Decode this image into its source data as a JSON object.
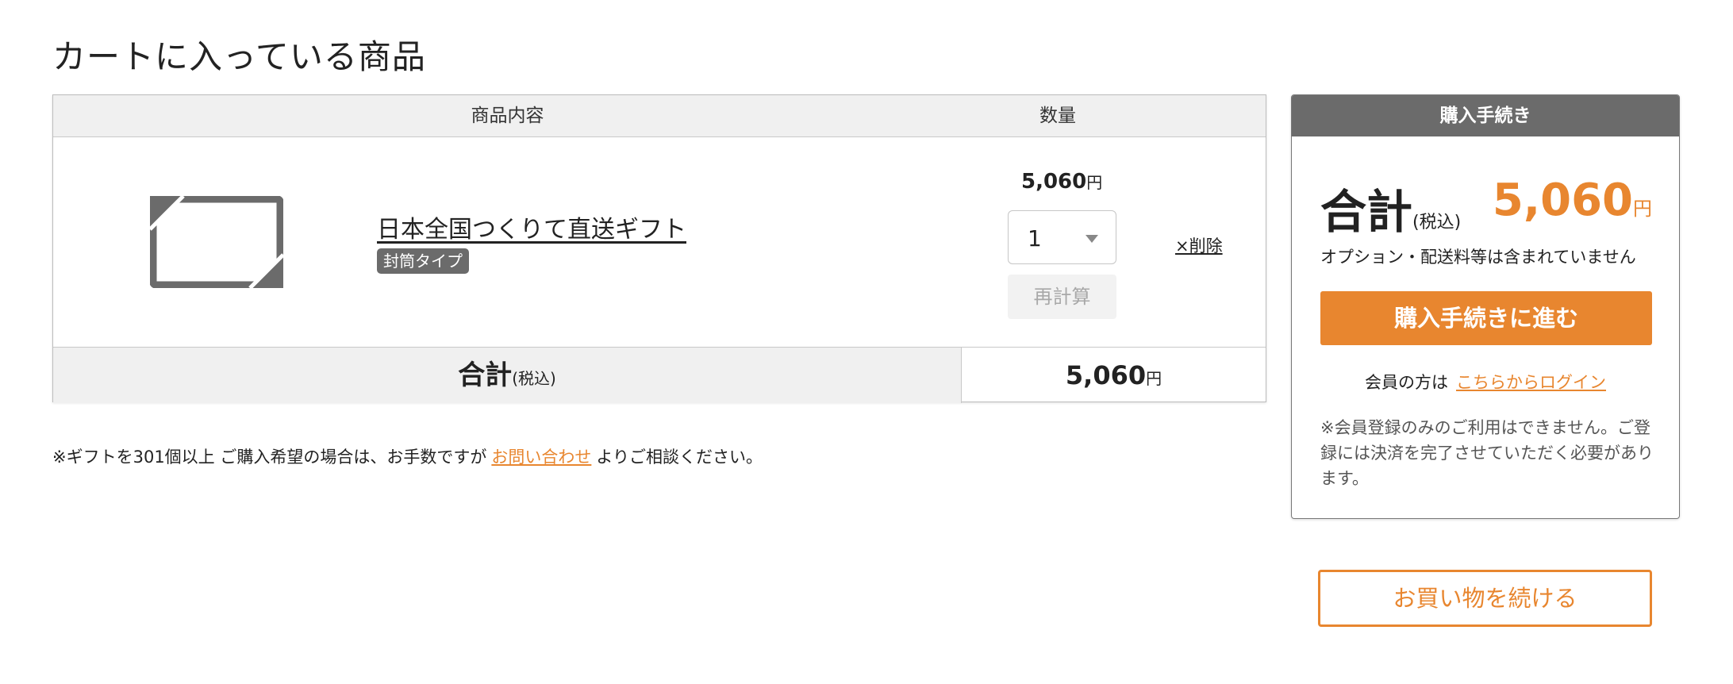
{
  "page_title": "カートに入っている商品",
  "cart": {
    "header": {
      "item_col": "商品内容",
      "qty_col": "数量"
    },
    "item": {
      "thumbnail_icon": "envelope-placeholder-icon",
      "name": "日本全国つくりて直送ギフト",
      "type_badge": "封筒タイプ",
      "unit_price": "5,060",
      "yen": "円",
      "quantity": "1",
      "recalc_label": "再計算",
      "delete_label": "×削除"
    },
    "footer": {
      "total_label": "合計",
      "tax_label": "(税込)",
      "total_price": "5,060",
      "yen": "円"
    }
  },
  "note": {
    "before": "※ギフトを301個以上 ご購入希望の場合は、お手数ですが",
    "link": "お問い合わせ",
    "after": "よりご相談ください。"
  },
  "side_panel": {
    "title": "購入手続き",
    "total_label": "合計",
    "tax_label": "(税込)",
    "total_price": "5,060",
    "yen": "円",
    "option_note": "オプション・配送料等は含まれていません",
    "checkout_label": "購入手続きに進む",
    "member_text": "会員の方は",
    "login_link": "こちらからログイン",
    "warning": "※会員登録のみのご利用はできません。ご登録には決済を完了させていただく必要があります。"
  },
  "continue_label": "お買い物を続ける",
  "colors": {
    "accent": "#e8862f",
    "header_gray": "#6b6b6b",
    "table_head_bg": "#f0f0f0"
  }
}
